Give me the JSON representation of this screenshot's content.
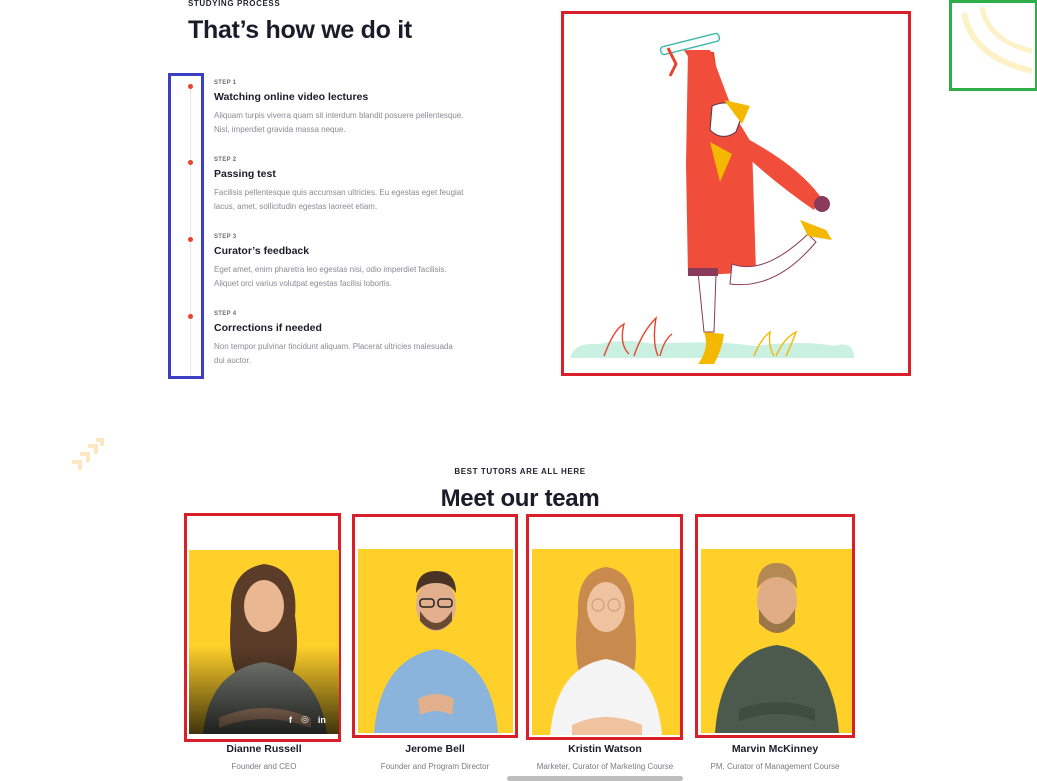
{
  "process": {
    "eyebrow": "STUDYING PROCESS",
    "title": "That’s how we do it",
    "steps": [
      {
        "label": "STEP 1",
        "name": "Watching online video lectures",
        "desc": "Aliquam turpis viverra quam sit interdum blandit posuere pellentesque. Nisl, imperdiet gravida massa neque."
      },
      {
        "label": "STEP 2",
        "name": "Passing test",
        "desc": "Facilisis pellentesque quis accumsan ultricies. Eu egestas eget feugiat lacus, amet, sollicitudin egestas laoreet etiam."
      },
      {
        "label": "STEP 3",
        "name": "Curator’s feedback",
        "desc": "Eget amet, enim pharetra leo egestas nisi, odio imperdiet facilisis. Aliquet orci varius volutpat egestas facilisi lobortis."
      },
      {
        "label": "STEP 4",
        "name": "Corrections if needed",
        "desc": "Non tempor pulvinar tincidunt aliquam. Placerat ultricies malesuada dui auctor."
      }
    ]
  },
  "team": {
    "eyebrow": "BEST TUTORS ARE ALL HERE",
    "title": "Meet our team",
    "members": [
      {
        "name": "Dianne Russell",
        "role": "Founder and CEO"
      },
      {
        "name": "Jerome Bell",
        "role": "Founder and Program Director"
      },
      {
        "name": "Kristin Watson",
        "role": "Marketer, Curator of Marketing Course"
      },
      {
        "name": "Marvin McKinney",
        "role": "PM, Curator of Management Course"
      }
    ],
    "social_icons": [
      "f",
      "◎",
      "in"
    ]
  },
  "colors": {
    "accent_red": "#e8432f",
    "photo_yellow": "#ffd02a",
    "frame_red": "#d91f2a",
    "frame_blue": "#3b3fc4",
    "frame_green": "#2eae4a"
  }
}
